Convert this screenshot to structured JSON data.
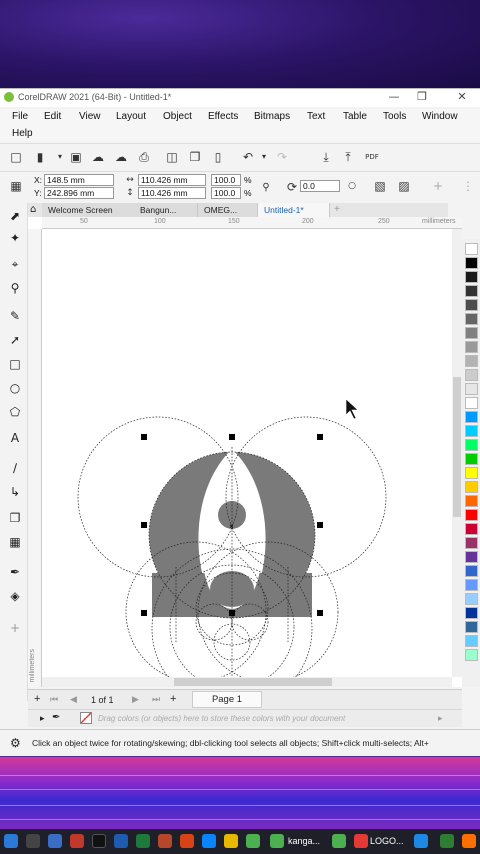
{
  "window": {
    "title": "CorelDRAW 2021 (64-Bit) - Untitled-1*",
    "controls": [
      "—",
      "❒",
      "✕"
    ]
  },
  "menu": [
    "File",
    "Edit",
    "View",
    "Layout",
    "Object",
    "Effects",
    "Bitmaps",
    "Text",
    "Table",
    "Tools",
    "Window",
    "Help"
  ],
  "propbar": {
    "x_label": "X:",
    "x_value": "148.5 mm",
    "y_label": "Y:",
    "y_value": "242.896 mm",
    "width_value": "110.426 mm",
    "height_value": "110.426 mm",
    "scale_x": "100.0",
    "scale_y": "100.0",
    "percent": "%",
    "rotation": "0.0"
  },
  "tabs": [
    "Welcome Screen",
    "Bangun...",
    "OMEG...",
    "Untitled-1*"
  ],
  "ruler": {
    "top": [
      "50",
      "100",
      "150",
      "200",
      "250",
      "millimeters"
    ],
    "left": [
      "millimeters"
    ]
  },
  "pagebar": {
    "page_count": "1 of 1",
    "page_tab": "Page 1"
  },
  "colorbar": {
    "hint": "Drag colors (or objects) here to store these colors with your document"
  },
  "status": {
    "text": "Click an object twice for rotating/skewing; dbl-clicking tool selects all objects; Shift+click multi-selects; Alt+"
  },
  "palette": [
    "#ffffff",
    "#000000",
    "#1a1a1a",
    "#333333",
    "#4d4d4d",
    "#666666",
    "#808080",
    "#999999",
    "#b3b3b3",
    "#cccccc",
    "#e6e6e6",
    "#ffffff",
    "#0099ff",
    "#00ccff",
    "#00ff66",
    "#00cc00",
    "#ffff00",
    "#ffcc00",
    "#ff6600",
    "#ff0000",
    "#cc0033",
    "#993366",
    "#663399",
    "#3366cc",
    "#6699ff",
    "#99ccff",
    "#003399",
    "#336699",
    "#66ccff",
    "#99ffcc"
  ],
  "taskbar": {
    "labels": [
      "kanga...",
      "LOGO..."
    ]
  },
  "colors": {
    "shape_fill": "#7a7a7a",
    "accent": "#1a5fb4"
  }
}
